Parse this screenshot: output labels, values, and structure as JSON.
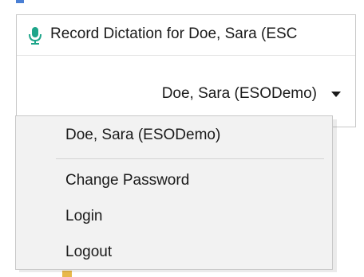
{
  "window": {
    "title": "Record Dictation for Doe, Sara (ESC"
  },
  "user_selector": {
    "selected": "Doe, Sara (ESODemo)"
  },
  "menu": {
    "items": [
      {
        "label": "Doe, Sara (ESODemo)"
      },
      {
        "label": "Change Password"
      },
      {
        "label": "Login"
      },
      {
        "label": "Logout"
      }
    ]
  },
  "colors": {
    "mic_icon": "#1ea58a",
    "menu_background": "#f2f2f2",
    "border": "#c8c8c8"
  },
  "icons": [
    "microphone-icon",
    "chevron-down-icon"
  ]
}
